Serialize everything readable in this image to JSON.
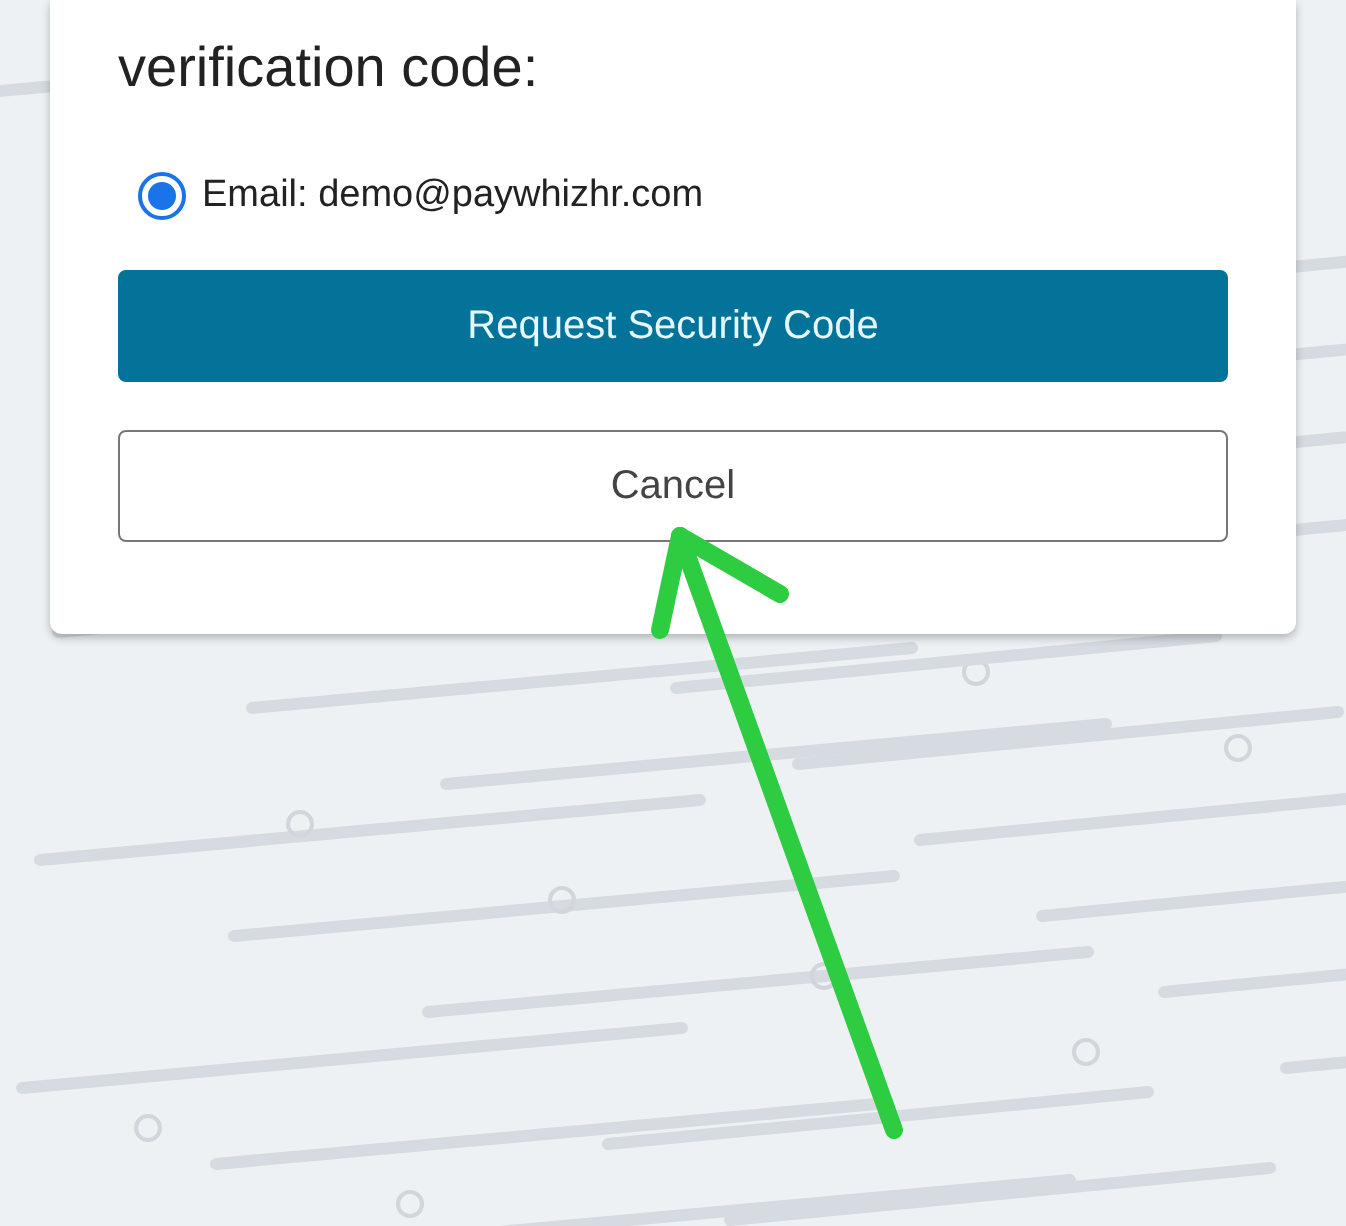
{
  "title": "verification code:",
  "options": [
    {
      "label": "Email: demo@paywhizhr.com",
      "selected": true
    }
  ],
  "buttons": [
    {
      "label": "Request Security Code",
      "kind": "primary"
    },
    {
      "label": "Cancel",
      "kind": "secondary"
    }
  ]
}
